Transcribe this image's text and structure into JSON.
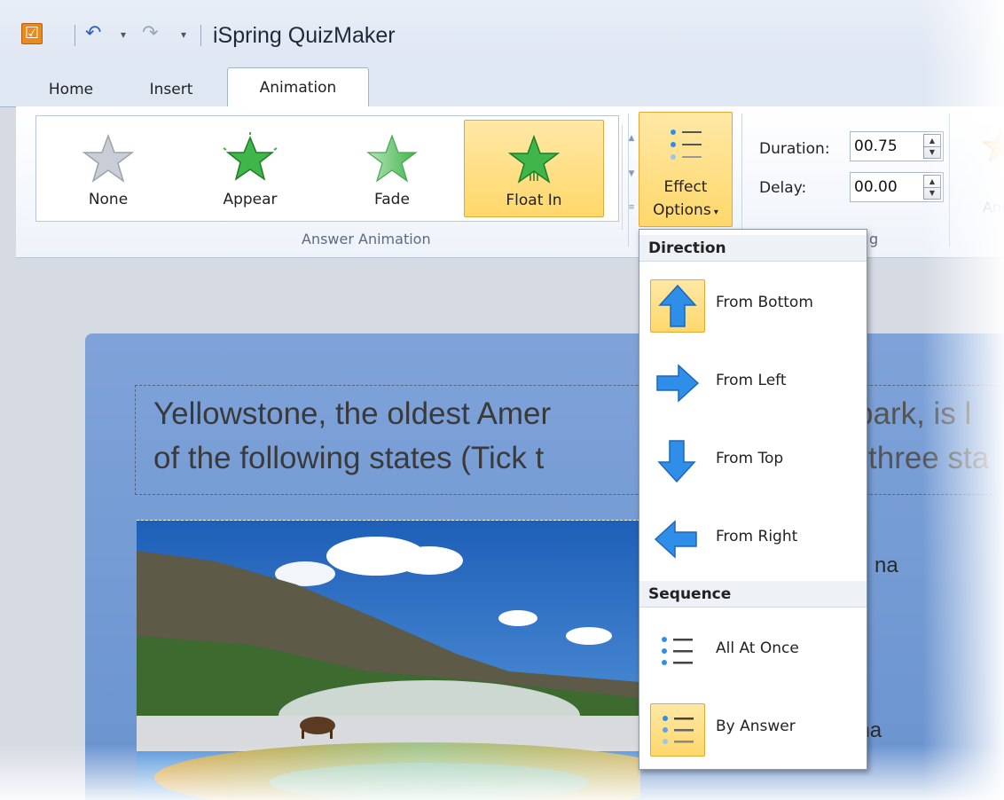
{
  "app": {
    "title": "iSpring QuizMaker",
    "icon_mark": "☑"
  },
  "tabs": [
    {
      "label": "Home",
      "active": false
    },
    {
      "label": "Insert",
      "active": false
    },
    {
      "label": "Animation",
      "active": true
    }
  ],
  "answer_animation": {
    "group_label": "Answer Animation",
    "items": [
      {
        "label": "None",
        "icon": "star-gray-icon",
        "selected": false
      },
      {
        "label": "Appear",
        "icon": "star-appear-icon",
        "selected": false
      },
      {
        "label": "Fade",
        "icon": "star-fade-icon",
        "selected": false
      },
      {
        "label": "Float In",
        "icon": "star-float-icon",
        "selected": true
      }
    ]
  },
  "effect_options": {
    "line1": "Effect",
    "line2": "Options"
  },
  "timing": {
    "duration_label": "Duration:",
    "duration_value": "00.75",
    "delay_label": "Delay:",
    "delay_value": "00.00",
    "group_label_fragment": "g"
  },
  "preview_fragment": {
    "line1": "P",
    "line2": "Anir"
  },
  "slide": {
    "question_line1": "Yellowstone, the oldest Amer",
    "question_line1_tail": "park, is l",
    "question_line2": "of the following states (Tick t",
    "question_line2_tail": "three sta",
    "answer1_fragment": "na",
    "answer2_fragment": "ana"
  },
  "menu": {
    "direction_header": "Direction",
    "direction_items": [
      {
        "label": "From Bottom",
        "icon": "arrow-up-icon",
        "selected": true
      },
      {
        "label": "From Left",
        "icon": "arrow-right-icon",
        "selected": false
      },
      {
        "label": "From Top",
        "icon": "arrow-down-icon",
        "selected": false
      },
      {
        "label": "From Right",
        "icon": "arrow-left-icon",
        "selected": false
      }
    ],
    "sequence_header": "Sequence",
    "sequence_items": [
      {
        "label": "All At Once",
        "icon": "list-icon",
        "selected": false
      },
      {
        "label": "By Answer",
        "icon": "list-icon",
        "selected": true
      }
    ]
  },
  "colors": {
    "accent_selected": "#ffd86b",
    "arrow_blue": "#2f8fe8",
    "star_green": "#3fb54a",
    "slide_blue": "#7fa3d9"
  }
}
